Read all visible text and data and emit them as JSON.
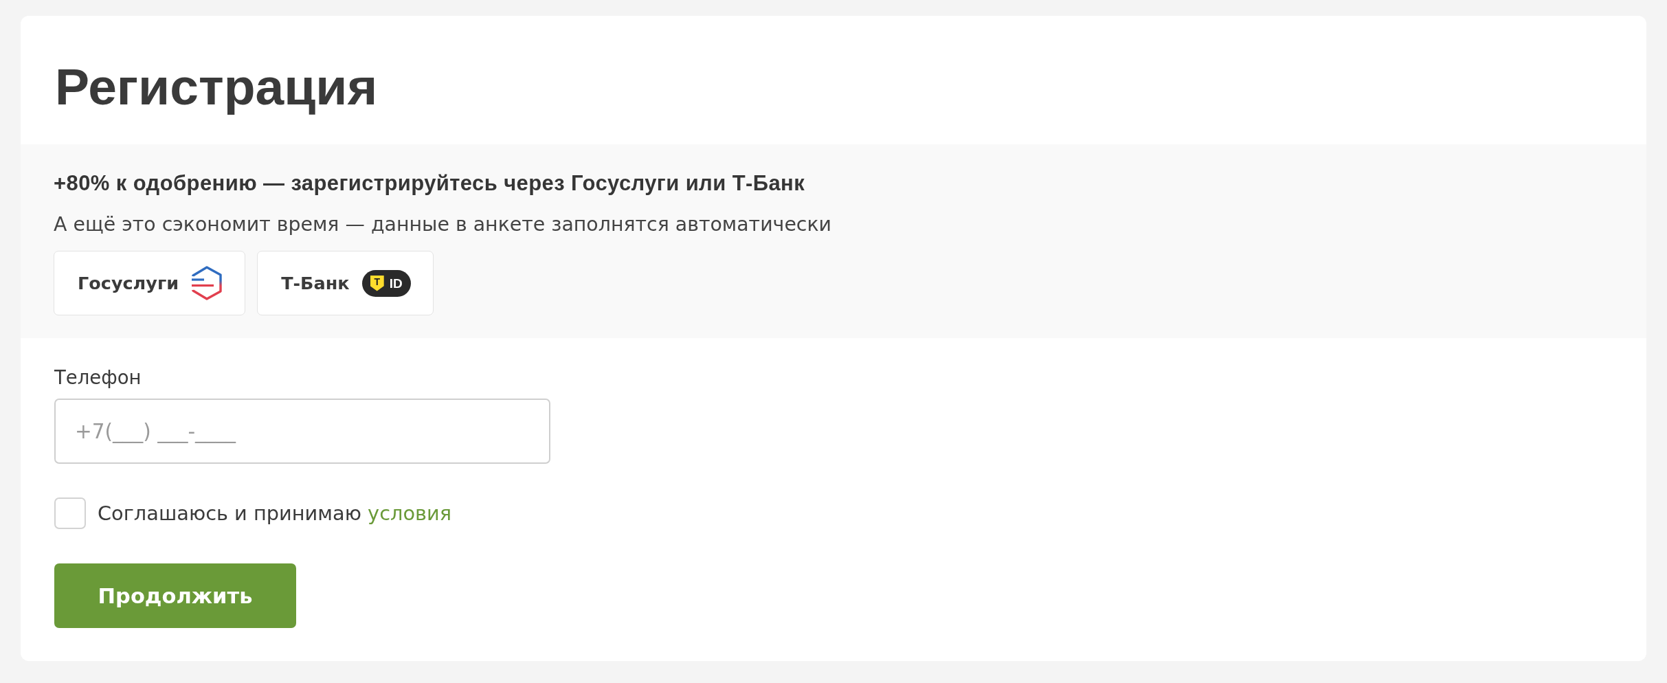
{
  "title": "Регистрация",
  "promo": {
    "heading": "+80% к одобрению — зарегистрируйтесь через Госуслуги или Т-Банк",
    "note": "А ещё это сэкономит время — данные в анкете заполнятся автоматически",
    "providers": [
      {
        "kind": "gosuslugi",
        "label": "Госуслуги"
      },
      {
        "kind": "tbank",
        "label": "Т-Банк",
        "badge_letter": "T",
        "badge_text": "ID"
      }
    ]
  },
  "form": {
    "phone": {
      "label": "Телефон",
      "placeholder": "+7(___) ___-____"
    },
    "agreement": {
      "checked": false,
      "text": "Соглашаюсь и принимаю",
      "link": "условия"
    },
    "submit": "Продолжить"
  }
}
